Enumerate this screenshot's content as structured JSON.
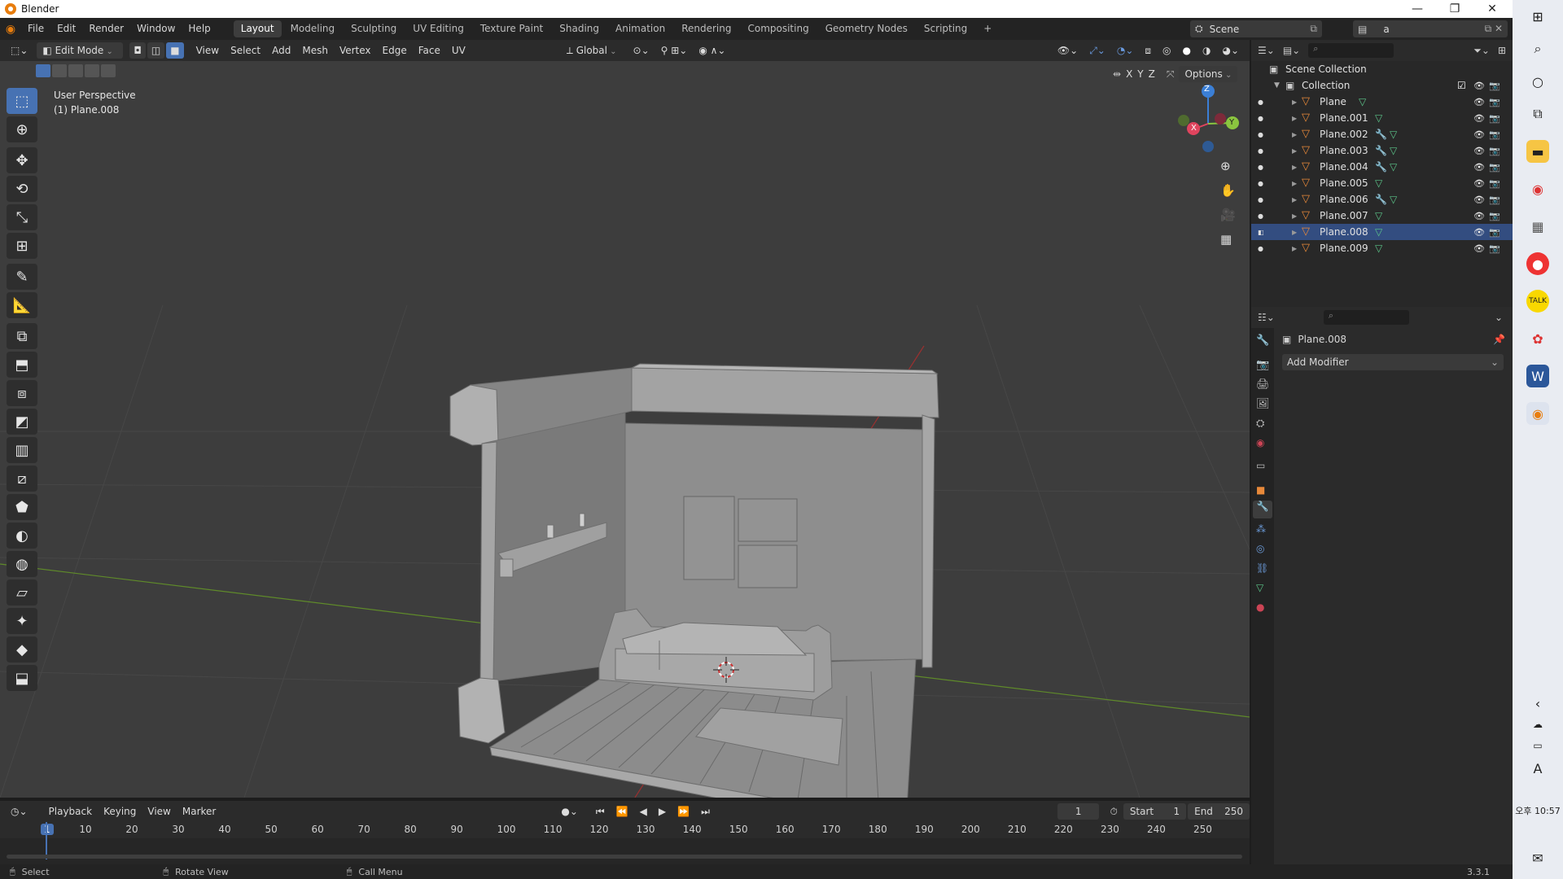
{
  "titlebar": {
    "title": "Blender",
    "minimize": "—",
    "maximize": "❐",
    "close": "✕"
  },
  "menu": {
    "items": [
      "File",
      "Edit",
      "Render",
      "Window",
      "Help"
    ]
  },
  "workspaces": {
    "tabs": [
      "Layout",
      "Modeling",
      "Sculpting",
      "UV Editing",
      "Texture Paint",
      "Shading",
      "Animation",
      "Rendering",
      "Compositing",
      "Geometry Nodes",
      "Scripting"
    ],
    "add": "+",
    "active": "Layout"
  },
  "scene": {
    "label": "Scene",
    "view_layer": "a"
  },
  "viewport_header": {
    "mode": "Edit Mode",
    "menus": [
      "View",
      "Select",
      "Add",
      "Mesh",
      "Vertex",
      "Edge",
      "Face",
      "UV"
    ],
    "orientation": "Global",
    "options": "Options",
    "axes": [
      "X",
      "Y",
      "Z"
    ]
  },
  "viewport": {
    "perspective": "User Perspective",
    "object": "(1) Plane.008"
  },
  "gizmo": {
    "x": "X",
    "y": "Y",
    "z": "Z"
  },
  "outliner": {
    "root": "Scene Collection",
    "collection": "Collection",
    "objects": [
      {
        "name": "Plane",
        "modifier": false,
        "selected": false
      },
      {
        "name": "Plane.001",
        "modifier": false,
        "selected": false
      },
      {
        "name": "Plane.002",
        "modifier": true,
        "selected": false
      },
      {
        "name": "Plane.003",
        "modifier": true,
        "selected": false
      },
      {
        "name": "Plane.004",
        "modifier": true,
        "selected": false
      },
      {
        "name": "Plane.005",
        "modifier": false,
        "selected": false
      },
      {
        "name": "Plane.006",
        "modifier": true,
        "selected": false
      },
      {
        "name": "Plane.007",
        "modifier": false,
        "selected": false
      },
      {
        "name": "Plane.008",
        "modifier": false,
        "selected": true
      },
      {
        "name": "Plane.009",
        "modifier": false,
        "selected": false
      }
    ]
  },
  "properties": {
    "object_name": "Plane.008",
    "add_modifier": "Add Modifier"
  },
  "timeline": {
    "menus": [
      "Playback",
      "Keying",
      "View",
      "Marker"
    ],
    "current_frame": "1",
    "start_label": "Start",
    "start": "1",
    "end_label": "End",
    "end": "250",
    "ticks": [
      "1",
      "10",
      "20",
      "30",
      "40",
      "50",
      "60",
      "70",
      "80",
      "90",
      "100",
      "110",
      "120",
      "130",
      "140",
      "150",
      "160",
      "170",
      "180",
      "190",
      "200",
      "210",
      "220",
      "230",
      "240",
      "250"
    ]
  },
  "statusbar": {
    "select": "Select",
    "rotate": "Rotate View",
    "call_menu": "Call Menu",
    "version": "3.3.1"
  },
  "taskbar": {
    "time": "오후 10:57",
    "ime": "A"
  },
  "colors": {
    "accent": "#4772b3",
    "selected_row": "#334d80",
    "viewport_bg": "#3d3d3d",
    "mesh": "#8f8f8f"
  }
}
